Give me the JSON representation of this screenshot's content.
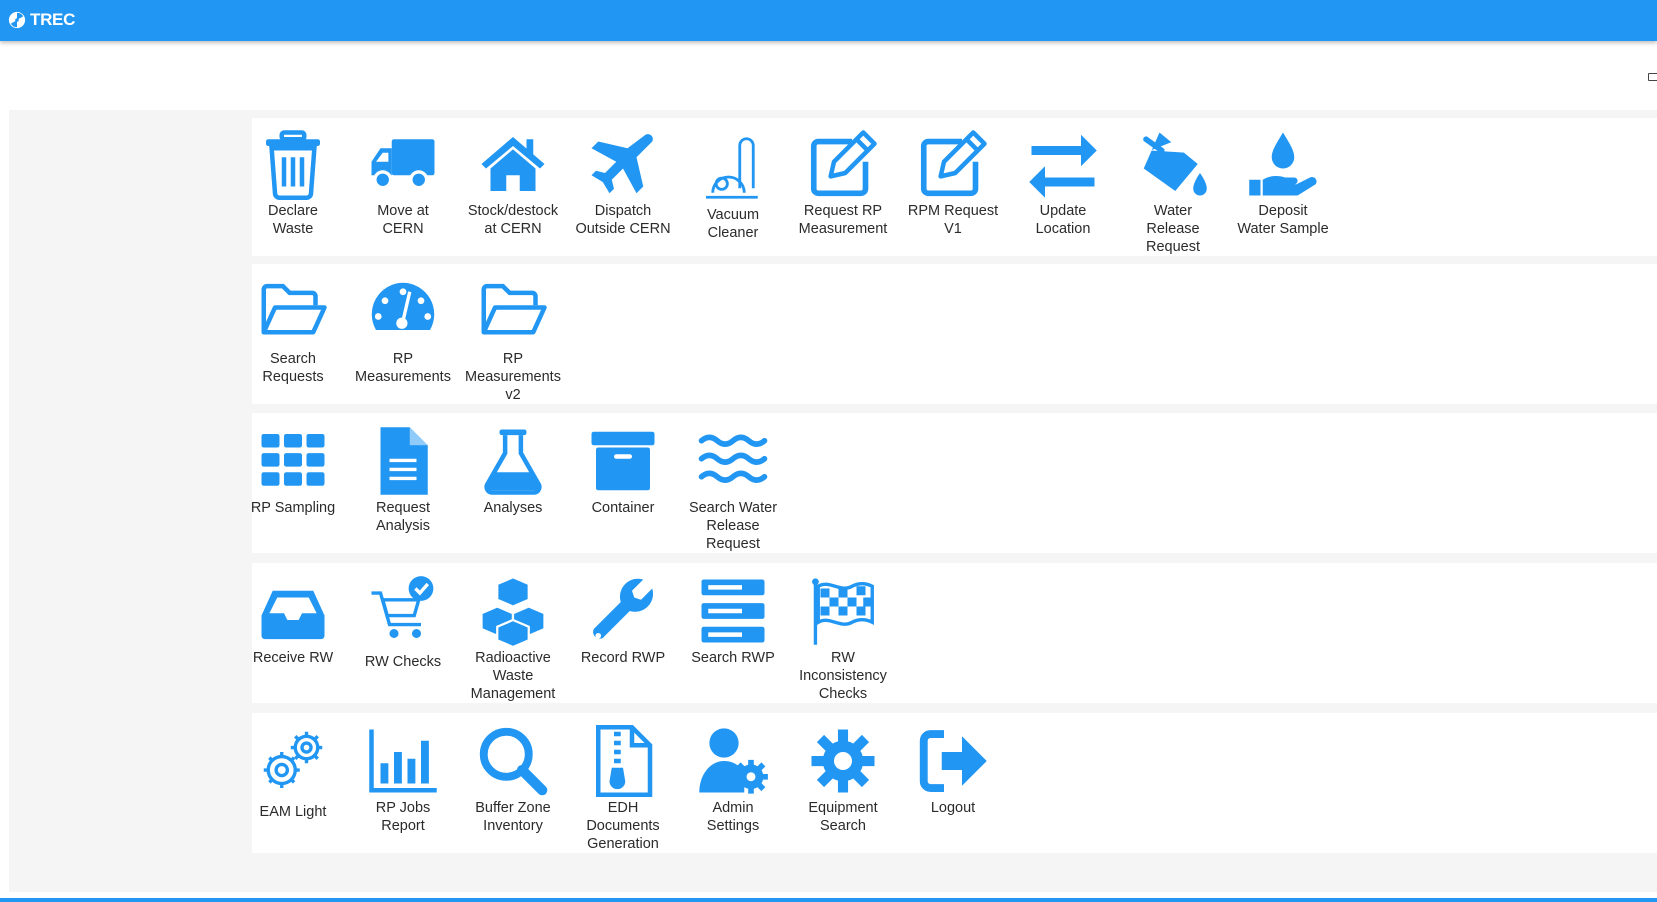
{
  "header": {
    "app_name": "TREC",
    "brand_icon": "radiation-icon",
    "bar_color": "#2196f3"
  },
  "colors": {
    "accent": "#2196f3",
    "background": "#f5f5f5",
    "card": "#ffffff"
  },
  "sections": [
    {
      "tiles": [
        {
          "label": "Declare\nWaste",
          "icon": "trash-icon"
        },
        {
          "label": "Move at\nCERN",
          "icon": "truck-icon"
        },
        {
          "label": "Stock/destock\nat CERN",
          "icon": "home-icon"
        },
        {
          "label": "Dispatch\nOutside CERN",
          "icon": "plane-icon"
        },
        {
          "label": "Vacuum\nCleaner",
          "icon": "vacuum-icon"
        },
        {
          "label": "Request RP\nMeasurement",
          "icon": "edit-icon"
        },
        {
          "label": "RPM Request\nV1",
          "icon": "edit-icon"
        },
        {
          "label": "Update\nLocation",
          "icon": "exchange-icon"
        },
        {
          "label": "Water\nRelease\nRequest",
          "icon": "fill-drip-icon"
        },
        {
          "label": "Deposit\nWater Sample",
          "icon": "hand-holding-water-icon"
        }
      ]
    },
    {
      "tiles": [
        {
          "label": "Search\nRequests",
          "icon": "folder-open-icon"
        },
        {
          "label": "RP\nMeasurements",
          "icon": "gauge-icon"
        },
        {
          "label": "RP\nMeasurements\nv2",
          "icon": "folder-open-icon"
        }
      ]
    },
    {
      "tiles": [
        {
          "label": "RP Sampling",
          "icon": "grid-icon"
        },
        {
          "label": "Request\nAnalysis",
          "icon": "document-icon"
        },
        {
          "label": "Analyses",
          "icon": "flask-icon"
        },
        {
          "label": "Container",
          "icon": "archive-box-icon"
        },
        {
          "label": "Search Water\nRelease\nRequest",
          "icon": "water-waves-icon"
        }
      ]
    },
    {
      "tiles": [
        {
          "label": "Receive RW",
          "icon": "inbox-icon"
        },
        {
          "label": "RW Checks",
          "icon": "cart-check-icon"
        },
        {
          "label": "Radioactive\nWaste\nManagement",
          "icon": "cubes-icon"
        },
        {
          "label": "Record RWP",
          "icon": "wrench-icon"
        },
        {
          "label": "Search RWP",
          "icon": "server-icon"
        },
        {
          "label": "RW\nInconsistency\nChecks",
          "icon": "checkered-flag-icon"
        }
      ]
    },
    {
      "tiles": [
        {
          "label": "EAM Light",
          "icon": "gears-icon"
        },
        {
          "label": "RP Jobs\nReport",
          "icon": "bar-chart-icon"
        },
        {
          "label": "Buffer Zone\nInventory",
          "icon": "search-icon"
        },
        {
          "label": "EDH\nDocuments\nGeneration",
          "icon": "file-zipper-icon"
        },
        {
          "label": "Admin\nSettings",
          "icon": "user-cog-icon"
        },
        {
          "label": "Equipment\nSearch",
          "icon": "cog-icon"
        },
        {
          "label": "Logout",
          "icon": "sign-out-icon"
        }
      ]
    }
  ]
}
